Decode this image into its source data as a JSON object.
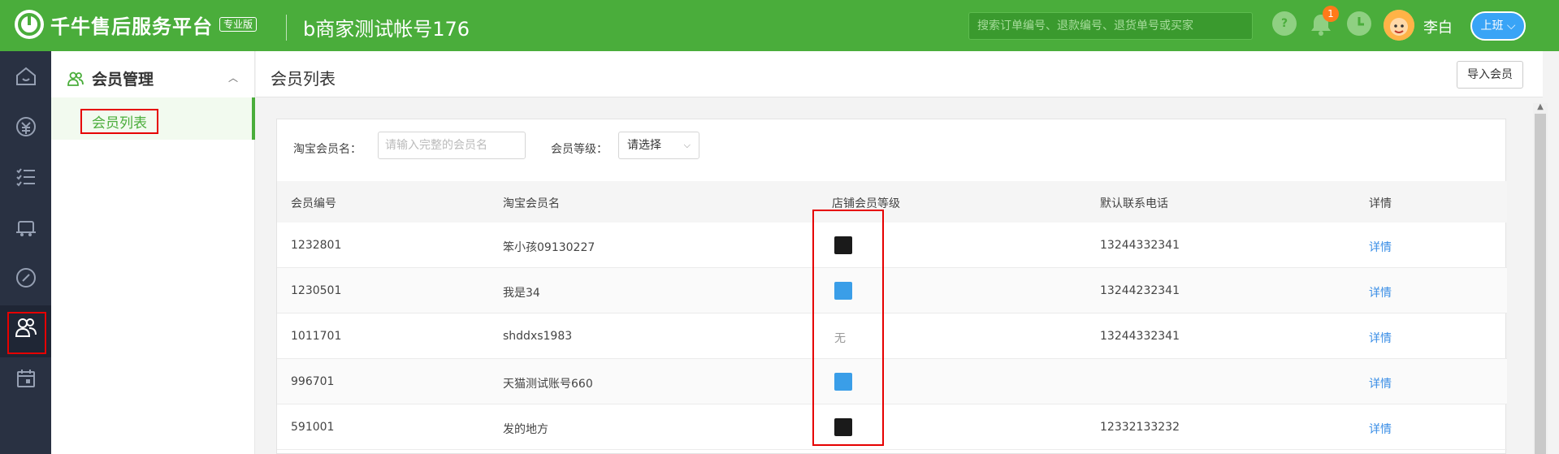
{
  "header": {
    "platform_title": "千牛售后服务平台",
    "edition_badge": "专业版",
    "account_name": "b商家测试帐号176",
    "search_placeholder": "搜索订单编号、退款编号、退货单号或买家",
    "notification_count": "1",
    "user_name": "李白",
    "shift_button": "上班",
    "colors": {
      "brand": "#4aad3b",
      "accent": "#39a4f6",
      "badge": "#ff7a1a"
    }
  },
  "sidebar": {
    "icons": [
      "home-icon",
      "finance-icon",
      "list-icon",
      "logistics-icon",
      "compass-icon",
      "members-icon",
      "calendar-icon"
    ],
    "active": "members-icon"
  },
  "subnav": {
    "section_title": "会员管理",
    "items": [
      {
        "label": "会员列表"
      }
    ]
  },
  "page": {
    "title": "会员列表",
    "import_button": "导入会员"
  },
  "filters": {
    "member_name_label": "淘宝会员名：",
    "member_name_placeholder": "请输入完整的会员名",
    "level_label": "会员等级：",
    "level_value": "请选择"
  },
  "table": {
    "headers": [
      "会员编号",
      "淘宝会员名",
      "店铺会员等级",
      "默认联系电话",
      "详情"
    ],
    "rows": [
      {
        "id": "1232801",
        "name": "笨小孩09130227",
        "level": "black",
        "level_text": "",
        "phone": "13244332341",
        "detail": "详情"
      },
      {
        "id": "1230501",
        "name": "我是34",
        "level": "blue",
        "level_text": "",
        "phone": "13244232341",
        "detail": "详情"
      },
      {
        "id": "1011701",
        "name": "shddxs1983",
        "level": "none",
        "level_text": "无",
        "phone": "13244332341",
        "detail": "详情"
      },
      {
        "id": "996701",
        "name": "天猫测试账号660",
        "level": "blue",
        "level_text": "",
        "phone": "",
        "detail": "详情"
      },
      {
        "id": "591001",
        "name": "发的地方",
        "level": "black",
        "level_text": "",
        "phone": "12332133232",
        "detail": "详情"
      }
    ]
  }
}
